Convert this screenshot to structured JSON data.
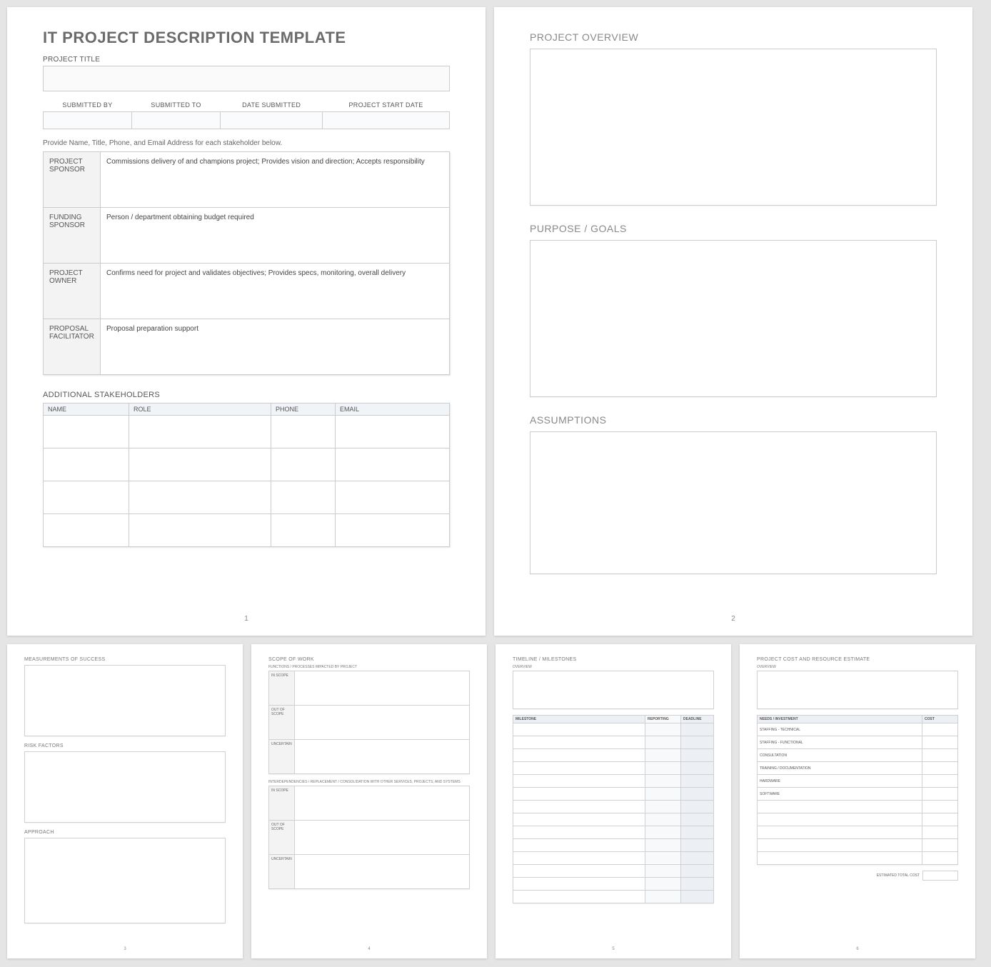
{
  "page1": {
    "title": "IT PROJECT DESCRIPTION TEMPLATE",
    "project_title_label": "PROJECT TITLE",
    "meta": [
      "SUBMITTED BY",
      "SUBMITTED TO",
      "DATE SUBMITTED",
      "PROJECT START DATE"
    ],
    "instruction": "Provide Name, Title, Phone, and Email Address for each stakeholder below.",
    "stakeholders": [
      {
        "role": "PROJECT SPONSOR",
        "desc": "Commissions delivery of and champions project; Provides vision and direction; Accepts responsibility"
      },
      {
        "role": "FUNDING SPONSOR",
        "desc": "Person / department obtaining budget required"
      },
      {
        "role": "PROJECT OWNER",
        "desc": "Confirms need for project and validates objectives; Provides specs, monitoring, overall delivery"
      },
      {
        "role": "PROPOSAL FACILITATOR",
        "desc": "Proposal preparation support"
      }
    ],
    "additional_heading": "ADDITIONAL STAKEHOLDERS",
    "additional_cols": [
      "NAME",
      "ROLE",
      "PHONE",
      "EMAIL"
    ],
    "pnum": "1"
  },
  "page2": {
    "sections": [
      "PROJECT OVERVIEW",
      "PURPOSE / GOALS",
      "ASSUMPTIONS"
    ],
    "pnum": "2"
  },
  "page3": {
    "sections": [
      "MEASUREMENTS OF SUCCESS",
      "RISK FACTORS",
      "APPROACH"
    ],
    "pnum": "3"
  },
  "page4": {
    "heading": "SCOPE OF WORK",
    "sub1": "FUNCTIONS / PROCESSES IMPACTED BY PROJECT",
    "sub2": "INTERDEPENDENCIES / REPLACEMENT / CONSOLIDATION WITH OTHER SERVICES, PROJECTS, AND SYSTEMS",
    "rows": [
      "IN SCOPE",
      "OUT OF SCOPE",
      "UNCERTAIN"
    ],
    "pnum": "4"
  },
  "page5": {
    "heading": "TIMELINE / MILESTONES",
    "overview": "OVERVIEW",
    "cols": [
      "MILESTONE",
      "REPORTING",
      "DEADLINE"
    ],
    "pnum": "5"
  },
  "page6": {
    "heading": "PROJECT COST AND RESOURCE ESTIMATE",
    "overview": "OVERVIEW",
    "cols": [
      "NEEDS / INVESTMENT",
      "COST"
    ],
    "rows": [
      "STAFFING - TECHNICAL",
      "STAFFING - FUNCTIONAL",
      "CONSULTATION",
      "TRAINING / DOCUMENTATION",
      "HARDWARE",
      "SOFTWARE",
      "",
      "",
      "",
      "",
      ""
    ],
    "total_label": "ESTIMATED TOTAL COST",
    "pnum": "6"
  }
}
